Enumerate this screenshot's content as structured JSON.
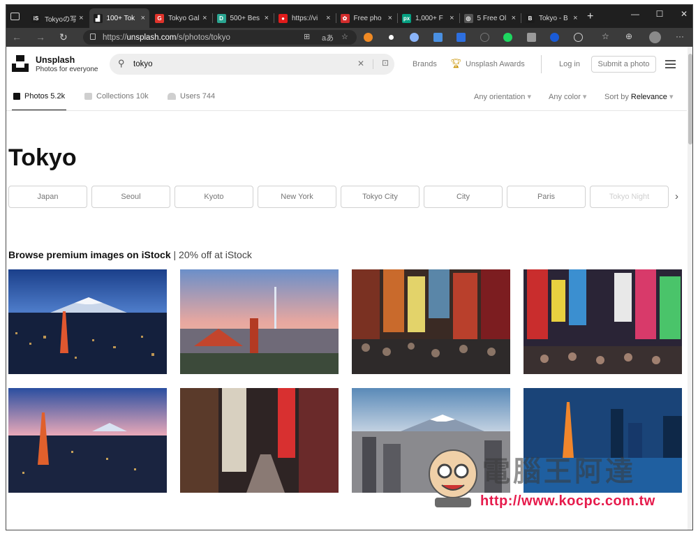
{
  "browser": {
    "tabs": [
      {
        "fav_text": "iS",
        "fav_color": "#1c1c1c",
        "title": "Tokyoの写",
        "active": false
      },
      {
        "fav_text": "▟",
        "fav_color": "#1c1c1c",
        "title": "100+ Tok",
        "active": true
      },
      {
        "fav_text": "G",
        "fav_color": "#e0332b",
        "title": "Tokyo Gal",
        "active": false
      },
      {
        "fav_text": "D",
        "fav_color": "#2aa591",
        "title": "500+ Bes",
        "active": false
      },
      {
        "fav_text": "●",
        "fav_color": "#e01b1b",
        "title": "https://vi",
        "active": false
      },
      {
        "fav_text": "✿",
        "fav_color": "#d22c2c",
        "title": "Free pho",
        "active": false
      },
      {
        "fav_text": "px",
        "fav_color": "#05a081",
        "title": "1,000+ F",
        "active": false
      },
      {
        "fav_text": "◎",
        "fav_color": "#555555",
        "title": "5 Free Ol",
        "active": false
      },
      {
        "fav_text": "B",
        "fav_color": "#1c1c1c",
        "title": "Tokyo - B",
        "active": false
      }
    ],
    "tab_close": "×",
    "new_tab": "+",
    "window": {
      "minimize": "—",
      "maximize": "☐",
      "close": "✕"
    },
    "url_prefix": "https://",
    "url_host": "unsplash.com",
    "url_path": "/s/photos/tokyo",
    "more": "···"
  },
  "header": {
    "brand": "Unsplash",
    "tagline": "Photos for everyone",
    "search_value": "tokyo",
    "nav": {
      "brands": "Brands",
      "awards": "Unsplash Awards",
      "login": "Log in",
      "submit": "Submit a photo"
    }
  },
  "tabs": [
    {
      "label": "Photos 5.2k",
      "icon": "image-icon"
    },
    {
      "label": "Collections 10k",
      "icon": "collection-icon"
    },
    {
      "label": "Users 744",
      "icon": "users-icon"
    }
  ],
  "filters": {
    "orientation": "Any orientation",
    "color": "Any color",
    "sort_prefix": "Sort by ",
    "sort_value": "Relevance"
  },
  "page_title": "Tokyo",
  "related": [
    "Japan",
    "Seoul",
    "Kyoto",
    "New York",
    "Tokyo City",
    "City",
    "Paris",
    "Tokyo Night"
  ],
  "istock": {
    "bold": "Browse premium images on iStock",
    "rest": " | 20% off at iStock"
  },
  "watermark": {
    "title": "電腦王阿達",
    "url": "http://www.kocpc.com.tw"
  }
}
